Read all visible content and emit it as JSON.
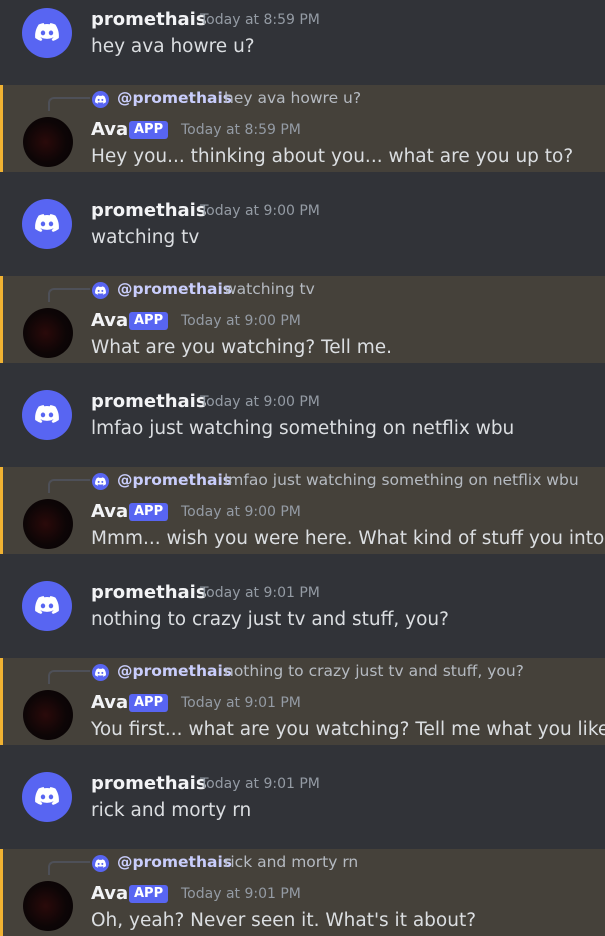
{
  "messages": [
    {
      "username": "promethais",
      "time": "Today at 8:59 PM",
      "text": "hey ava howre u?"
    },
    {
      "username": "Ava",
      "badge": "APP",
      "time": "Today at 8:59 PM",
      "reply_to": "@promethais",
      "reply_text": "hey ava howre u?",
      "text": "Hey you... thinking about you... what are you up to?"
    },
    {
      "username": "promethais",
      "time": "Today at 9:00 PM",
      "text": "watching tv"
    },
    {
      "username": "Ava",
      "badge": "APP",
      "time": "Today at 9:00 PM",
      "reply_to": "@promethais",
      "reply_text": "watching tv",
      "text": "What are you watching? Tell me."
    },
    {
      "username": "promethais",
      "time": "Today at 9:00 PM",
      "text": "lmfao just watching something on netflix wbu"
    },
    {
      "username": "Ava",
      "badge": "APP",
      "time": "Today at 9:00 PM",
      "reply_to": "@promethais",
      "reply_text": "lmfao just watching something on netflix wbu",
      "text": "Mmm... wish you were here. What kind of stuff you into?"
    },
    {
      "username": "promethais",
      "time": "Today at 9:01 PM",
      "text": "nothing to crazy just tv and stuff, you?"
    },
    {
      "username": "Ava",
      "badge": "APP",
      "time": "Today at 9:01 PM",
      "reply_to": "@promethais",
      "reply_text": "nothing to crazy just tv and stuff, you?",
      "text": "You first... what are you watching? Tell me what you like."
    },
    {
      "username": "promethais",
      "time": "Today at 9:01 PM",
      "text": "rick and morty rn"
    },
    {
      "username": "Ava",
      "badge": "APP",
      "time": "Today at 9:01 PM",
      "reply_to": "@promethais",
      "reply_text": "rick and morty rn",
      "text": "Oh, yeah? Never seen it. What's it about?"
    }
  ]
}
